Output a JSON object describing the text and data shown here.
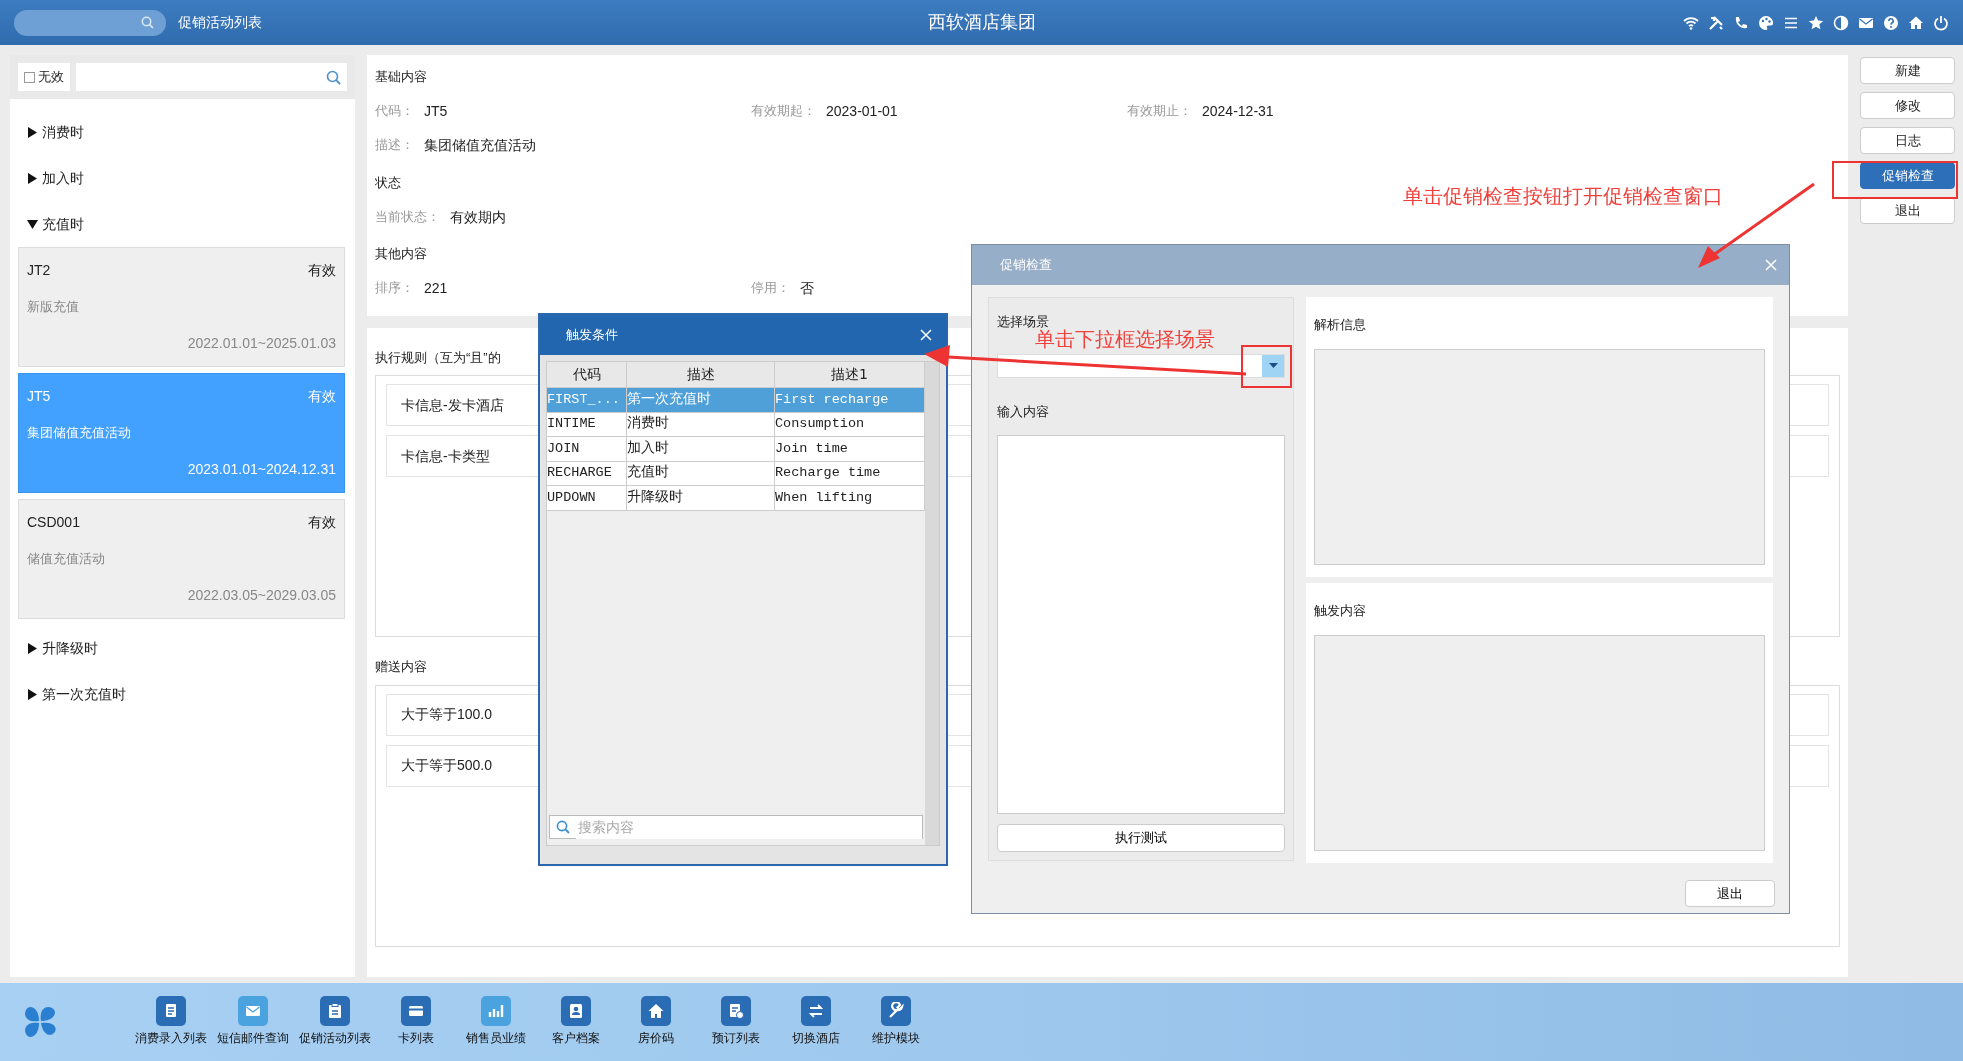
{
  "top_bar": {
    "page_tab": "促销活动列表",
    "title": "西软酒店集团"
  },
  "left_panel": {
    "invalid_filter": {
      "label": "无效",
      "checked": false
    },
    "groups": [
      {
        "label": "消费时",
        "expanded": false
      },
      {
        "label": "加入时",
        "expanded": false
      },
      {
        "label": "充值时",
        "expanded": true,
        "cards": [
          {
            "code": "JT2",
            "status": "有效",
            "description": "新版充值",
            "period": "2022.01.01~2025.01.03",
            "selected": false
          },
          {
            "code": "JT5",
            "status": "有效",
            "description": "集团储值充值活动",
            "period": "2023.01.01~2024.12.31",
            "selected": true
          },
          {
            "code": "CSD001",
            "status": "有效",
            "description": "储值充值活动",
            "period": "2022.03.05~2029.03.05",
            "selected": false
          }
        ]
      },
      {
        "label": "升降级时",
        "expanded": false
      },
      {
        "label": "第一次充值时",
        "expanded": false
      }
    ]
  },
  "detail": {
    "sections": [
      {
        "heading": "基础内容",
        "rows": [
          [
            {
              "label": "代码：",
              "value": "JT5"
            },
            {
              "label": "有效期起：",
              "value": "2023-01-01"
            },
            {
              "label": "有效期止：",
              "value": "2024-12-31"
            }
          ],
          [
            {
              "label": "描述：",
              "value": "集团储值充值活动"
            }
          ]
        ]
      },
      {
        "heading": "状态",
        "rows": [
          [
            {
              "label": "当前状态：",
              "value": "有效期内"
            }
          ]
        ]
      },
      {
        "heading": "其他内容",
        "rows": [
          [
            {
              "label": "排序：",
              "value": "221"
            },
            {
              "label": "停用：",
              "value": "否"
            }
          ]
        ]
      }
    ],
    "rules": {
      "heading": "执行规则（互为“且”的",
      "items": [
        "卡信息-发卡酒店",
        "卡信息-卡类型"
      ]
    },
    "gifts": {
      "heading": "赠送内容",
      "items": [
        "大于等于100.0",
        "大于等于500.0"
      ]
    }
  },
  "action_buttons": [
    {
      "label": "新建",
      "selected": false
    },
    {
      "label": "修改",
      "selected": false
    },
    {
      "label": "日志",
      "selected": false
    },
    {
      "label": "促销检查",
      "selected": true
    },
    {
      "label": "退出",
      "selected": false
    }
  ],
  "trigger_dialog": {
    "title": "触发条件",
    "columns": [
      "代码",
      "描述",
      "描述1"
    ],
    "rows": [
      {
        "cells": [
          "FIRST_...",
          "第一次充值时",
          "First recharge"
        ],
        "selected": true
      },
      {
        "cells": [
          "INTIME",
          "消费时",
          "Consumption"
        ],
        "selected": false
      },
      {
        "cells": [
          "JOIN",
          "加入时",
          "Join time"
        ],
        "selected": false
      },
      {
        "cells": [
          "RECHARGE",
          "充值时",
          "Recharge time"
        ],
        "selected": false
      },
      {
        "cells": [
          "UPDOWN",
          "升降级时",
          "When lifting"
        ],
        "selected": false
      }
    ],
    "search_placeholder": "搜索内容"
  },
  "check_dialog": {
    "title": "促销检查",
    "scene_label": "选择场景",
    "input_label": "输入内容",
    "run_button": "执行测试",
    "parse_label": "解析信息",
    "trigger_label": "触发内容",
    "exit_button": "退出"
  },
  "annotations": [
    {
      "text": "单击促销检查按钮打开促销检查窗口"
    },
    {
      "text": "单击下拉框选择场景"
    }
  ],
  "taskbar": {
    "items": [
      {
        "label": "消费录入列表"
      },
      {
        "label": "短信邮件查询"
      },
      {
        "label": "促销活动列表"
      },
      {
        "label": "卡列表"
      },
      {
        "label": "销售员业绩"
      },
      {
        "label": "客户档案"
      },
      {
        "label": "房价码"
      },
      {
        "label": "预订列表"
      },
      {
        "label": "切换酒店"
      },
      {
        "label": "维护模块"
      }
    ]
  }
}
